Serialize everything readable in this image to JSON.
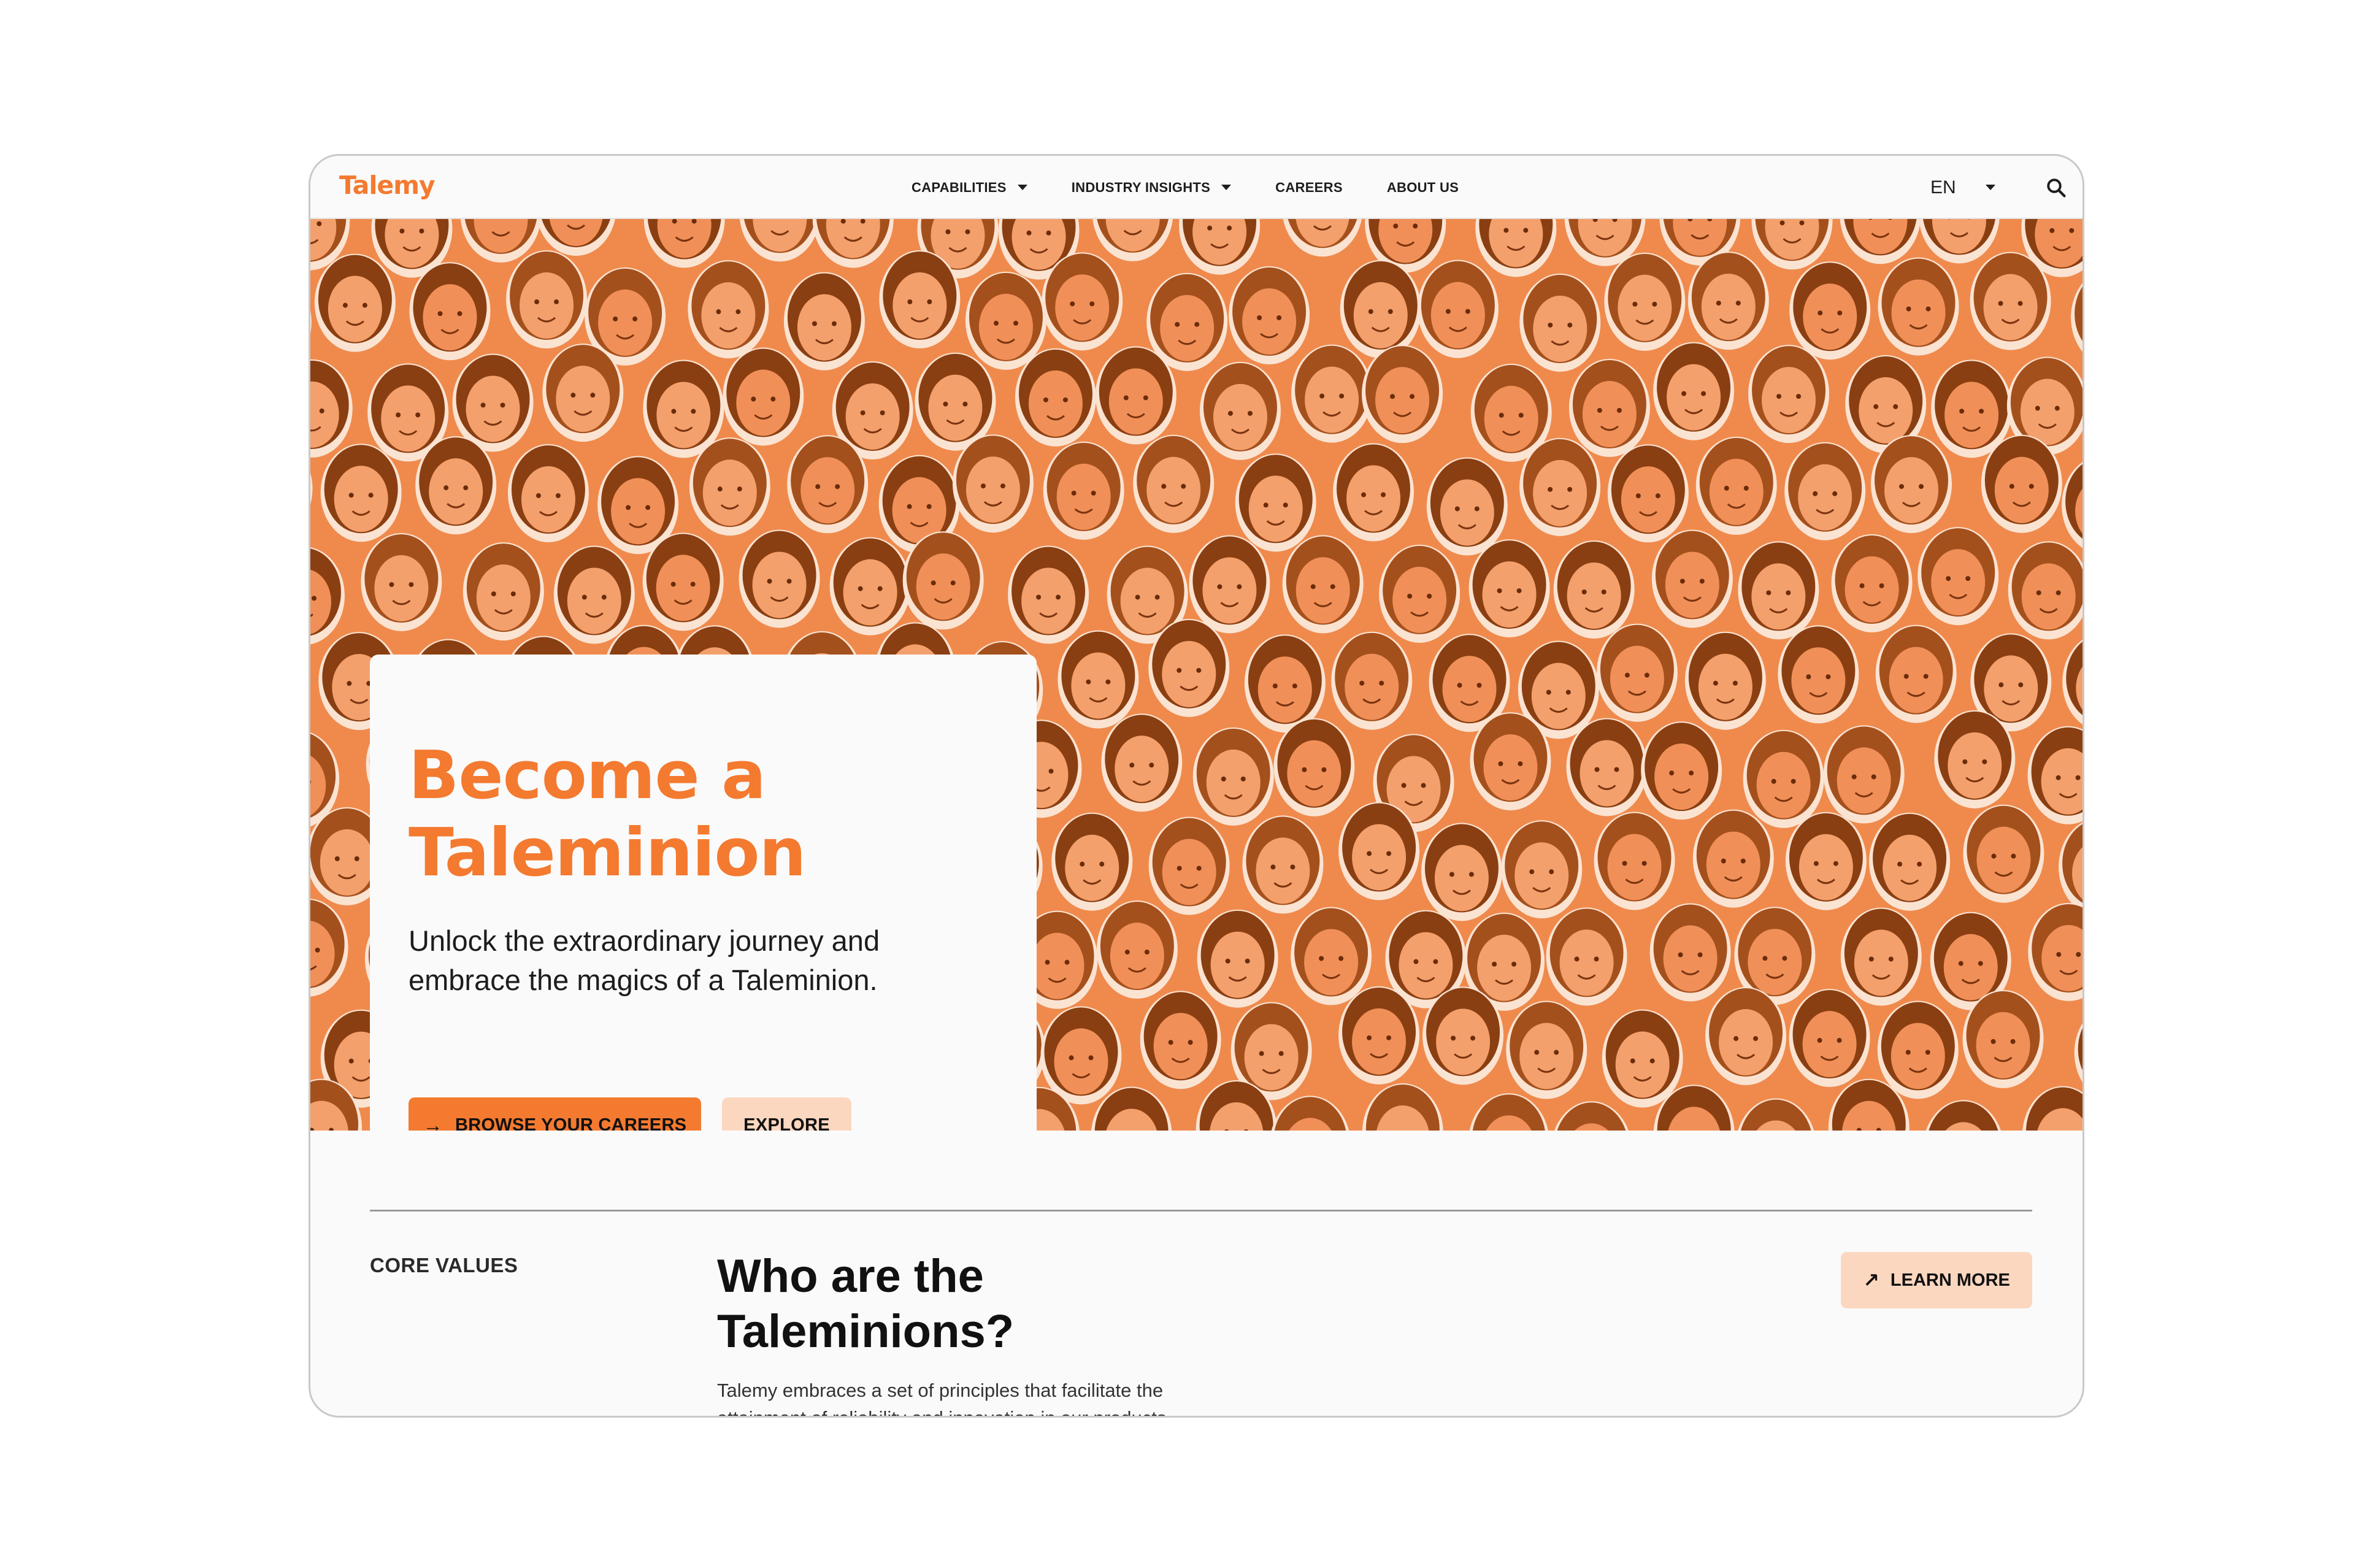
{
  "nav": {
    "logo": "Talemy",
    "items": [
      {
        "label": "CAPABILITIES",
        "has_dropdown": true
      },
      {
        "label": "INDUSTRY INSIGHTS",
        "has_dropdown": true
      },
      {
        "label": "CAREERS",
        "has_dropdown": false
      },
      {
        "label": "ABOUT US",
        "has_dropdown": false
      }
    ],
    "language": "EN",
    "search_icon": "search-icon"
  },
  "hero": {
    "background_color": "#ef8a4c",
    "title": "Become a Taleminion",
    "subtitle": "Unlock the extraordinary journey and embrace the magics of a Taleminion.",
    "primary_button": {
      "label": "BROWSE YOUR CAREERS",
      "icon": "arrow-right-icon"
    },
    "secondary_button": {
      "label": "EXPLORE"
    }
  },
  "core_values": {
    "label": "CORE VALUES",
    "title": "Who are the Taleminions?",
    "body": "Talemy embraces a set of principles that facilitate the attainment of reliability and innovation in our products",
    "button": {
      "label": "LEARN MORE",
      "icon": "arrow-up-right-icon"
    }
  },
  "colors": {
    "accent": "#f47a30",
    "accent_light": "#fcd7c0",
    "page_bg": "#fafafa"
  }
}
